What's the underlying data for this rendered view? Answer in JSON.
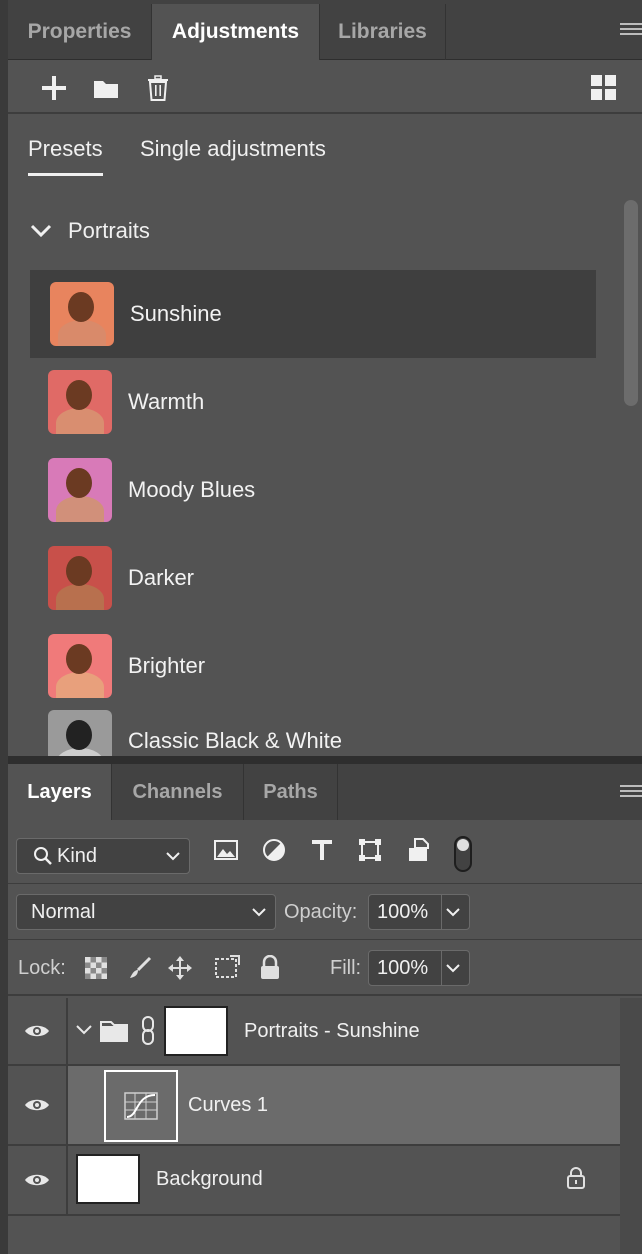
{
  "top_tabs": [
    "Properties",
    "Adjustments",
    "Libraries"
  ],
  "active_top_tab": "Adjustments",
  "subtabs": {
    "presets": "Presets",
    "single": "Single adjustments"
  },
  "section": {
    "title": "Portraits"
  },
  "presets": [
    {
      "label": "Sunshine",
      "thumb_bg": "#e8845e",
      "body_color": "#d98a6a",
      "selected": true
    },
    {
      "label": "Warmth",
      "thumb_bg": "#e06a66",
      "body_color": "#d98e70"
    },
    {
      "label": "Moody Blues",
      "thumb_bg": "#d87ab8",
      "body_color": "#d1907a"
    },
    {
      "label": "Darker",
      "thumb_bg": "#c8504a",
      "body_color": "#b8704e"
    },
    {
      "label": "Brighter",
      "thumb_bg": "#f07a7a",
      "body_color": "#e8a07c"
    },
    {
      "label": "Classic Black & White",
      "thumb_bg": "#9a9a9a",
      "body_color": "#cccccc"
    }
  ],
  "layers_tabs": [
    "Layers",
    "Channels",
    "Paths"
  ],
  "filter": {
    "kind_label": "Kind"
  },
  "blend": {
    "mode": "Normal",
    "opacity_label": "Opacity:",
    "opacity_value": "100%"
  },
  "lock": {
    "lock_label": "Lock:",
    "fill_label": "Fill:",
    "fill_value": "100%"
  },
  "layers": [
    {
      "name": "Portraits - Sunshine",
      "type": "group"
    },
    {
      "name": "Curves 1",
      "type": "adjustment",
      "selected": true
    },
    {
      "name": "Background",
      "type": "background",
      "locked": true
    }
  ],
  "colors": {
    "panel_bg": "#535353",
    "tab_bg": "#424242",
    "selected_row": "#3f3f3f",
    "selected_layer": "#6b6b6b"
  }
}
